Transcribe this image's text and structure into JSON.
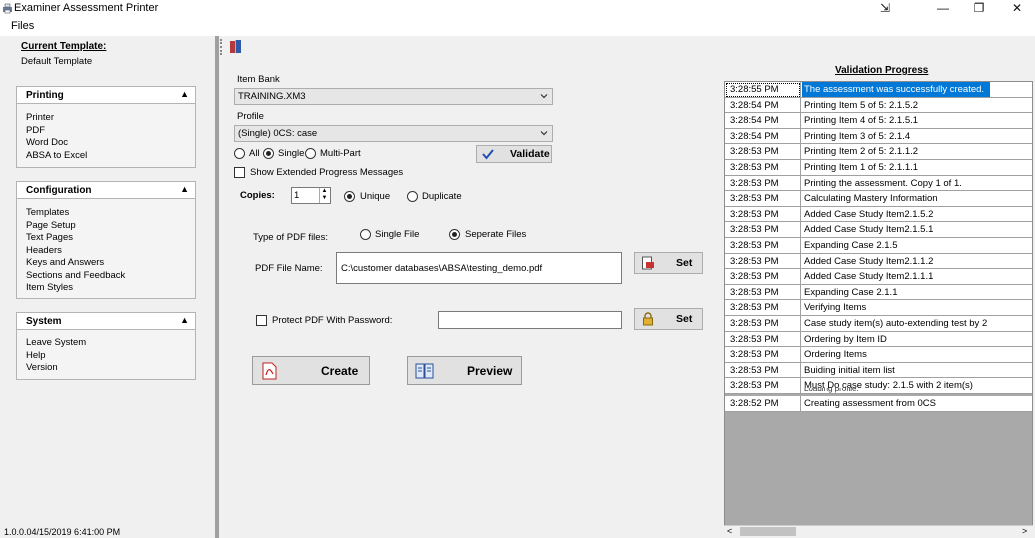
{
  "window": {
    "title": "Examiner Assessment Printer",
    "controls": {
      "pin": "⇲",
      "minimize": "—",
      "restore": "❐",
      "close": "✕"
    }
  },
  "menu": {
    "files": "Files"
  },
  "left": {
    "current_template_label": "Current Template:",
    "current_template_value": "Default Template",
    "groups": [
      {
        "title": "Printing",
        "items": [
          "Printer",
          "PDF",
          "Word Doc",
          "ABSA to Excel"
        ]
      },
      {
        "title": "Configuration",
        "items": [
          "Templates",
          "Page Setup",
          "Text Pages",
          "Headers",
          "Keys and Answers",
          "Sections and Feedback",
          "Item Styles"
        ]
      },
      {
        "title": "System",
        "items": [
          "Leave System",
          "Help",
          "Version"
        ]
      }
    ],
    "version": "1.0.0.04/15/2019 6:41:00 PM"
  },
  "form": {
    "item_bank_label": "Item Bank",
    "item_bank_value": "TRAINING.XM3",
    "profile_label": "Profile",
    "profile_value": "(Single)  0CS: case",
    "mode": {
      "all": "All",
      "single": "Single",
      "multi": "Multi-Part",
      "selected": "single"
    },
    "validate": "Validate",
    "show_extended": "Show Extended Progress Messages",
    "copies_label": "Copies:",
    "copies_value": "1",
    "unique": "Unique",
    "duplicate": "Duplicate",
    "pdf_type_label": "Type of PDF files:",
    "single_file": "Single File",
    "separate_files": "Seperate Files",
    "pdf_name_label": "PDF File Name:",
    "pdf_name_value": "C:\\customer databases\\ABSA\\testing_demo.pdf",
    "set": "Set",
    "protect_label": "Protect PDF With Password:",
    "password_value": "",
    "create": "Create",
    "preview": "Preview"
  },
  "progress": {
    "title": "Validation Progress",
    "rows": [
      {
        "time": "3:28:55 PM",
        "msg": "The assessment was successfully created."
      },
      {
        "time": "3:28:54 PM",
        "msg": "Printing Item 5 of 5: 2.1.5.2"
      },
      {
        "time": "3:28:54 PM",
        "msg": "Printing Item 4 of 5: 2.1.5.1"
      },
      {
        "time": "3:28:54 PM",
        "msg": "Printing Item 3 of 5: 2.1.4"
      },
      {
        "time": "3:28:53 PM",
        "msg": "Printing Item 2 of 5: 2.1.1.2"
      },
      {
        "time": "3:28:53 PM",
        "msg": "Printing Item 1 of 5: 2.1.1.1"
      },
      {
        "time": "3:28:53 PM",
        "msg": "Printing the assessment.  Copy 1 of 1."
      },
      {
        "time": "3:28:53 PM",
        "msg": "Calculating Mastery Information"
      },
      {
        "time": "3:28:53 PM",
        "msg": "Added Case Study Item2.1.5.2"
      },
      {
        "time": "3:28:53 PM",
        "msg": "Added Case Study Item2.1.5.1"
      },
      {
        "time": "3:28:53 PM",
        "msg": "Expanding Case 2.1.5"
      },
      {
        "time": "3:28:53 PM",
        "msg": "Added Case Study Item2.1.1.2"
      },
      {
        "time": "3:28:53 PM",
        "msg": "Added Case Study Item2.1.1.1"
      },
      {
        "time": "3:28:53 PM",
        "msg": "Expanding Case 2.1.1"
      },
      {
        "time": "3:28:53 PM",
        "msg": "Verifying Items"
      },
      {
        "time": "3:28:53 PM",
        "msg": "Case study item(s) auto-extending test by 2"
      },
      {
        "time": "3:28:53 PM",
        "msg": "Ordering by Item ID"
      },
      {
        "time": "3:28:53 PM",
        "msg": "Ordering Items"
      },
      {
        "time": "3:28:53 PM",
        "msg": "Buiding initial item list"
      },
      {
        "time": "3:28:53 PM",
        "msg": "Must Do case study: 2.1.5 with 2 item(s)"
      },
      {
        "time": "3:28:52 PM",
        "msg": "Creating assessment from 0CS"
      }
    ],
    "overlap_fragment": "Loading profile."
  }
}
